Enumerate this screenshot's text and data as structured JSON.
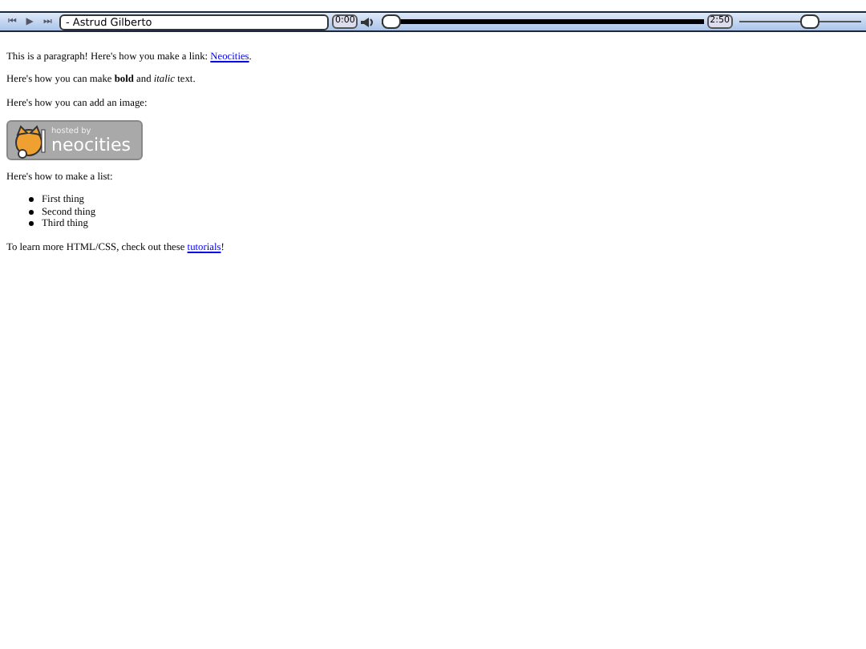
{
  "player": {
    "buttons": [
      "⏮",
      "▶",
      "⏭"
    ],
    "title": "- Astrud Gilberto",
    "elapsed": "0:00",
    "progress": {
      "level": 0.0
    },
    "duration": "2:50",
    "volume": {
      "level": 0.6
    }
  },
  "content": [
    {
      "kind": "paragraph",
      "text": "This is a paragraph! Here's how you make a link: ",
      "link": "Neocities",
      "after": "."
    },
    {
      "kind": "rich",
      "text": "Here's how you can make **bold** and *italic* text."
    },
    {
      "kind": "text",
      "text": "Here's how you can add an image:"
    },
    {
      "kind": "badge",
      "small": "hosted by",
      "big": "neocities"
    },
    {
      "kind": "text",
      "text": "Here's how to make a list:"
    },
    {
      "kind": "list",
      "items": [
        "First thing",
        "Second thing",
        "Third thing"
      ]
    },
    {
      "kind": "paragraph",
      "text": "To learn more HTML/CSS, check out these ",
      "link": "tutorials",
      "after": "!"
    }
  ]
}
